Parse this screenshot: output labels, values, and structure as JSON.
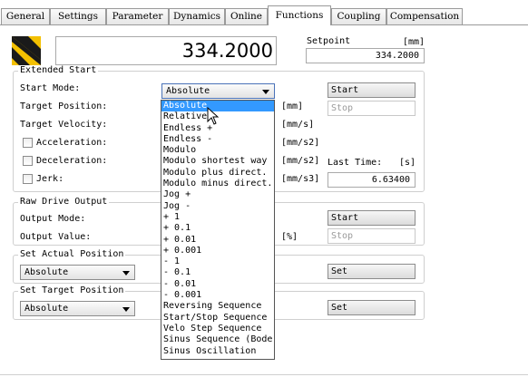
{
  "tabs": [
    {
      "label": "General"
    },
    {
      "label": "Settings"
    },
    {
      "label": "Parameter"
    },
    {
      "label": "Dynamics"
    },
    {
      "label": "Online"
    },
    {
      "label": "Functions"
    },
    {
      "label": "Coupling"
    },
    {
      "label": "Compensation"
    }
  ],
  "active_tab": "Functions",
  "display": {
    "value": "334.2000"
  },
  "setpoint": {
    "label": "Setpoint",
    "unit": "[mm]",
    "value": "334.2000"
  },
  "extended_start": {
    "title": "Extended Start",
    "start_mode_label": "Start Mode:",
    "start_mode_value": "Absolute",
    "target_position_label": "Target Position:",
    "target_position_unit": "[mm]",
    "target_velocity_label": "Target Velocity:",
    "target_velocity_unit": "[mm/s]",
    "acceleration_label": "Acceleration:",
    "acceleration_unit": "[mm/s2]",
    "deceleration_label": "Deceleration:",
    "deceleration_unit": "[mm/s2]",
    "jerk_label": "Jerk:",
    "jerk_unit": "[mm/s3]",
    "start_button": "Start",
    "stop_button": "Stop",
    "last_time_label": "Last Time:",
    "last_time_unit": "[s]",
    "last_time_value": "6.63400"
  },
  "raw_drive": {
    "title": "Raw Drive Output",
    "output_mode_label": "Output Mode:",
    "output_value_label": "Output Value:",
    "output_value_unit": "[%]",
    "start_button": "Start",
    "stop_button": "Stop"
  },
  "set_actual": {
    "title": "Set Actual Position",
    "combo_value": "Absolute",
    "set_button": "Set"
  },
  "set_target": {
    "title": "Set Target Position",
    "combo_value": "Absolute",
    "set_button": "Set"
  },
  "dropdown_items": [
    {
      "label": "Absolute"
    },
    {
      "label": "Relative"
    },
    {
      "label": "Endless +"
    },
    {
      "label": "Endless -"
    },
    {
      "label": "Modulo"
    },
    {
      "label": "Modulo shortest way"
    },
    {
      "label": "Modulo plus direct."
    },
    {
      "label": "Modulo minus direct."
    },
    {
      "label": "Jog +"
    },
    {
      "label": "Jog -"
    },
    {
      "label": "+ 1"
    },
    {
      "label": "+ 0.1"
    },
    {
      "label": "+ 0.01"
    },
    {
      "label": "+ 0.001"
    },
    {
      "label": "- 1"
    },
    {
      "label": "- 0.1"
    },
    {
      "label": "- 0.01"
    },
    {
      "label": "- 0.001"
    },
    {
      "label": "Reversing Sequence"
    },
    {
      "label": "Start/Stop Sequence"
    },
    {
      "label": "Velo Step Sequence"
    },
    {
      "label": "Sinus Sequence (Bode"
    },
    {
      "label": "Sinus Oscillation"
    }
  ],
  "dropdown_selected": "Absolute",
  "icons": {
    "status": "striped-status-icon",
    "cursor": "mouse-pointer-icon",
    "combo_arrow": "chevron-down-icon"
  },
  "colors": {
    "highlight": "#3399ff",
    "icon_yellow": "#f3c000",
    "icon_dark": "#1a1a1a"
  }
}
